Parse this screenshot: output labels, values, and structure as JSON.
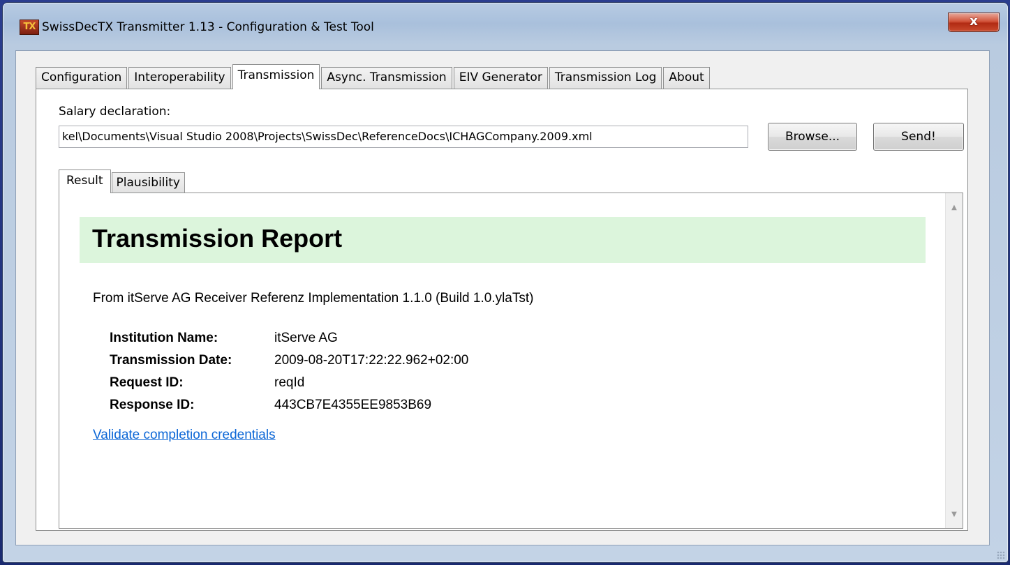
{
  "window": {
    "title": "SwissDecTX Transmitter 1.13 - Configuration & Test Tool",
    "app_icon_text": "TX",
    "close_glyph": "x"
  },
  "tabs": [
    {
      "label": "Configuration",
      "active": false
    },
    {
      "label": "Interoperability",
      "active": false
    },
    {
      "label": "Transmission",
      "active": true
    },
    {
      "label": "Async. Transmission",
      "active": false
    },
    {
      "label": "EIV Generator",
      "active": false
    },
    {
      "label": "Transmission Log",
      "active": false
    },
    {
      "label": "About",
      "active": false
    }
  ],
  "transmission": {
    "salary_label": "Salary declaration:",
    "path_value": "kel\\Documents\\Visual Studio 2008\\Projects\\SwissDec\\ReferenceDocs\\ICHAGCompany.2009.xml",
    "browse_label": "Browse...",
    "send_label": "Send!"
  },
  "subtabs": [
    {
      "label": "Result",
      "active": true
    },
    {
      "label": "Plausibility",
      "active": false
    }
  ],
  "report": {
    "title": "Transmission Report",
    "from_line": "From itServe AG Receiver Referenz Implementation 1.1.0 (Build 1.0.ylaTst)",
    "fields": [
      {
        "label": "Institution Name:",
        "value": "itServe AG"
      },
      {
        "label": "Transmission Date:",
        "value": "2009-08-20T17:22:22.962+02:00"
      },
      {
        "label": "Request ID:",
        "value": "reqId"
      },
      {
        "label": "Response ID:",
        "value": "443CB7E4355EE9853B69"
      }
    ],
    "link_text": "Validate completion credentials",
    "header_color": "#dcf5dc",
    "link_color": "#0b66d6"
  }
}
